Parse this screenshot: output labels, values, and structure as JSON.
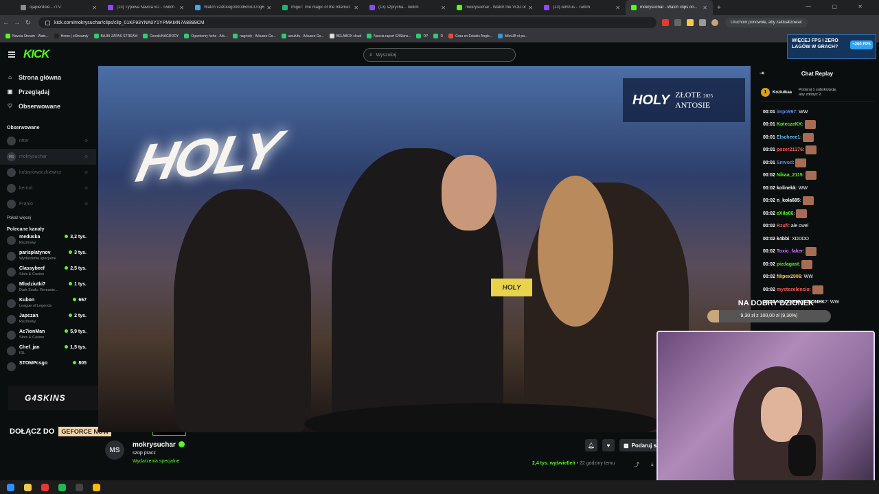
{
  "browser": {
    "tabs": [
      {
        "label": "ojapierdole - 7TV",
        "favicon_color": "#8b8d90",
        "active": false
      },
      {
        "label": "(13) Typowa Navcia xD - Twitch",
        "favicon_color": "#9146ff",
        "active": false
      },
      {
        "label": "Watch v24044g0000d5mi137og6...",
        "favicon_color": "#3ea6ff",
        "active": false
      },
      {
        "label": "Imgur: The magic of the Internet",
        "favicon_color": "#1bb76e",
        "active": false
      },
      {
        "label": "(13) szprycha - Twitch",
        "favicon_color": "#9146ff",
        "active": false
      },
      {
        "label": "mokrysuchar - Watch the VOD on...",
        "favicon_color": "#53fc18",
        "active": false
      },
      {
        "label": "(13) remzus - Twitch",
        "favicon_color": "#9146ff",
        "active": false
      },
      {
        "label": "mokrysuchar - Watch clips on...",
        "favicon_color": "#53fc18",
        "active": true
      }
    ],
    "new_tab": "+",
    "window_controls": "— ▢ ✕",
    "url": "kick.com/mokrysuchar/clips/clip_01KF93YNA0Y1YPMKMN7A8899CM",
    "relaunch_label": "Uruchom ponownie, aby zaktualizować",
    "bookmarks": [
      {
        "label": "Navcia Stream - Watc...",
        "color": "#53fc18"
      },
      {
        "label": "Home | eStreamly",
        "color": "#222"
      },
      {
        "label": "BAJKI ZAPAS STREAM",
        "color": "#2ecc71"
      },
      {
        "label": "Cennik/NAGRODY",
        "color": "#2ecc71"
      },
      {
        "label": "Ogarniemy hehe - Ark...",
        "color": "#2ecc71"
      },
      {
        "label": "nagrody - Arkusze Go...",
        "color": "#2ecc71"
      },
      {
        "label": "uwufufu - Arkusze Go...",
        "color": "#2ecc71"
      },
      {
        "label": "BELABOX cloud",
        "color": "#ddd"
      },
      {
        "label": "Navcia raport G4Skins...",
        "color": "#2ecc71"
      },
      {
        "label": "DP",
        "color": "#2ecc71"
      },
      {
        "label": "D",
        "color": "#2ecc71"
      },
      {
        "label": "Grau en Estudis Angle...",
        "color": "#e74c3c"
      },
      {
        "label": "MónUB el pa...",
        "color": "#3498db"
      }
    ]
  },
  "kick": {
    "logo": "KICK",
    "search_placeholder": "Wyszukaj",
    "ad": {
      "line1": "WIĘCEJ FPS I ZERO",
      "line2": "LAGÓW W GRACH?",
      "badge": "+200 FPS"
    },
    "nav": [
      {
        "label": "Strona główna",
        "icon": "home-icon",
        "glyph": "⌂"
      },
      {
        "label": "Przeglądaj",
        "icon": "browse-icon",
        "glyph": "▣"
      },
      {
        "label": "Obserwowane",
        "icon": "heart-icon",
        "glyph": "♡"
      }
    ],
    "following_header": "Obserwowane",
    "following": [
      {
        "name": "ntter",
        "initials": ""
      },
      {
        "name": "mokrysuchar",
        "initials": "MS",
        "selected": true
      },
      {
        "name": "kubanowaczkiewicz",
        "initials": ""
      },
      {
        "name": "kernol",
        "initials": ""
      },
      {
        "name": "Franio",
        "initials": ""
      }
    ],
    "show_more": "Pokaż więcej",
    "recommended_header": "Polecane kanały",
    "recommended": [
      {
        "name": "meduska",
        "category": "Rozmowy",
        "viewers": "3,2 tys."
      },
      {
        "name": "parisplatynov",
        "category": "Wydarzenia specjalne",
        "viewers": "3 tys."
      },
      {
        "name": "Classybeef",
        "category": "Slots & Casino",
        "viewers": "2,5 tys."
      },
      {
        "name": "Mlodziutki7",
        "category": "Dark Souls: Remaste...",
        "viewers": "1 tys."
      },
      {
        "name": "Kubon",
        "category": "League of Legends",
        "viewers": "667"
      },
      {
        "name": "Japczan",
        "category": "Rozmowy",
        "viewers": "2 tys."
      },
      {
        "name": "Ac7ionMan",
        "category": "Slots & Casino",
        "viewers": "5,9 tys."
      },
      {
        "name": "Chef_jan",
        "category": "IRL",
        "viewers": "1,5 tys."
      },
      {
        "name": "STOMPcsgo",
        "category": "",
        "viewers": "805"
      }
    ],
    "g4skins": "G4SKINS",
    "promo": {
      "text": "DOŁĄCZ DO",
      "brand": "GEFORCE NOW",
      "badge": "GEFORCE NOW"
    },
    "video": {
      "sign": "HOLY",
      "overlay_brand": "HOLY",
      "overlay_text_1": "ZŁOTE",
      "overlay_year": "2025",
      "overlay_text_2": "ANTOSIE",
      "mic_flag": "HOLY"
    },
    "channel": {
      "initials": "MS",
      "name": "mokrysuchar",
      "clip_title": "szop pracz",
      "category": "Wydarzenia specjalne",
      "views": "2,4 tys.",
      "views_label": "wyświetleń",
      "time": "• 22 godziny temu",
      "subscribe_label": "Podaruj s"
    },
    "chat": {
      "title": "Chat Replay",
      "pinned": {
        "rank": "1",
        "user": "Koziulkaa",
        "text_1": "Podaruj 1 subskrypcję,",
        "text_2": "aby zdobyć 2."
      },
      "messages": [
        {
          "time": "00:01",
          "user": "impo997",
          "color": "#5b8def",
          "text": ": WW",
          "emote": false
        },
        {
          "time": "00:01",
          "user": "KoteczeKK",
          "color": "#53fc18",
          "text": ":",
          "emote": true
        },
        {
          "time": "00:01",
          "user": "Elscheee1",
          "color": "#5bc0ff",
          "text": ":",
          "emote": true
        },
        {
          "time": "00:01",
          "user": "pozer21376",
          "color": "#ff5a5a",
          "text": ":",
          "emote": true
        },
        {
          "time": "00:01",
          "user": "Smvod",
          "color": "#5b8def",
          "text": ":",
          "emote": true
        },
        {
          "time": "00:02",
          "user": "Nikaa_2115",
          "color": "#53fc18",
          "text": ":",
          "emote": true
        },
        {
          "time": "00:02",
          "user": "kolinekk",
          "color": "#ffffff",
          "text": ": WW",
          "emote": false
        },
        {
          "time": "00:02",
          "user": "n_kola685",
          "color": "#ffffff",
          "text": ":",
          "emote": true
        },
        {
          "time": "00:02",
          "user": "eXilo86",
          "color": "#53fc18",
          "text": ":",
          "emote": true
        },
        {
          "time": "00:02",
          "user": "Rzufi",
          "color": "#ff5a5a",
          "text": ": ale cwel",
          "emote": false
        },
        {
          "time": "00:02",
          "user": "k4bbi",
          "color": "#ffffff",
          "text": ": XDDDD",
          "emote": false
        },
        {
          "time": "00:02",
          "user": "Toxic_faker",
          "color": "#c678ff",
          "text": ":",
          "emote": true
        },
        {
          "time": "00:02",
          "user": "pizdagast",
          "color": "#53fc18",
          "text": ":",
          "emote": true
        },
        {
          "time": "00:02",
          "user": "filipex2006",
          "color": "#ffd24a",
          "text": ": WW",
          "emote": false
        },
        {
          "time": "00:02",
          "user": "mystezelencio",
          "color": "#ff5a5a",
          "text": ":",
          "emote": true
        },
        {
          "time": "00:02",
          "user": "NA DOBRY DZIONEK",
          "color": "#ffffff",
          "text": "7: WW",
          "emote": false
        }
      ]
    },
    "goal": {
      "title": "NA DOBRY DZIONEK",
      "text": "9,30 zł z 100,00 zł (9,30%)",
      "progress": 0.093
    }
  },
  "taskbar": [
    {
      "icon": "windows-icon",
      "color": "#2f8fff"
    },
    {
      "icon": "explorer-icon",
      "color": "#f2c94c"
    },
    {
      "icon": "opera-icon",
      "color": "#e53935"
    },
    {
      "icon": "spotify-icon",
      "color": "#1db954"
    },
    {
      "icon": "obs-icon",
      "color": "#444"
    },
    {
      "icon": "chrome-icon",
      "color": "#fbbc05"
    }
  ]
}
